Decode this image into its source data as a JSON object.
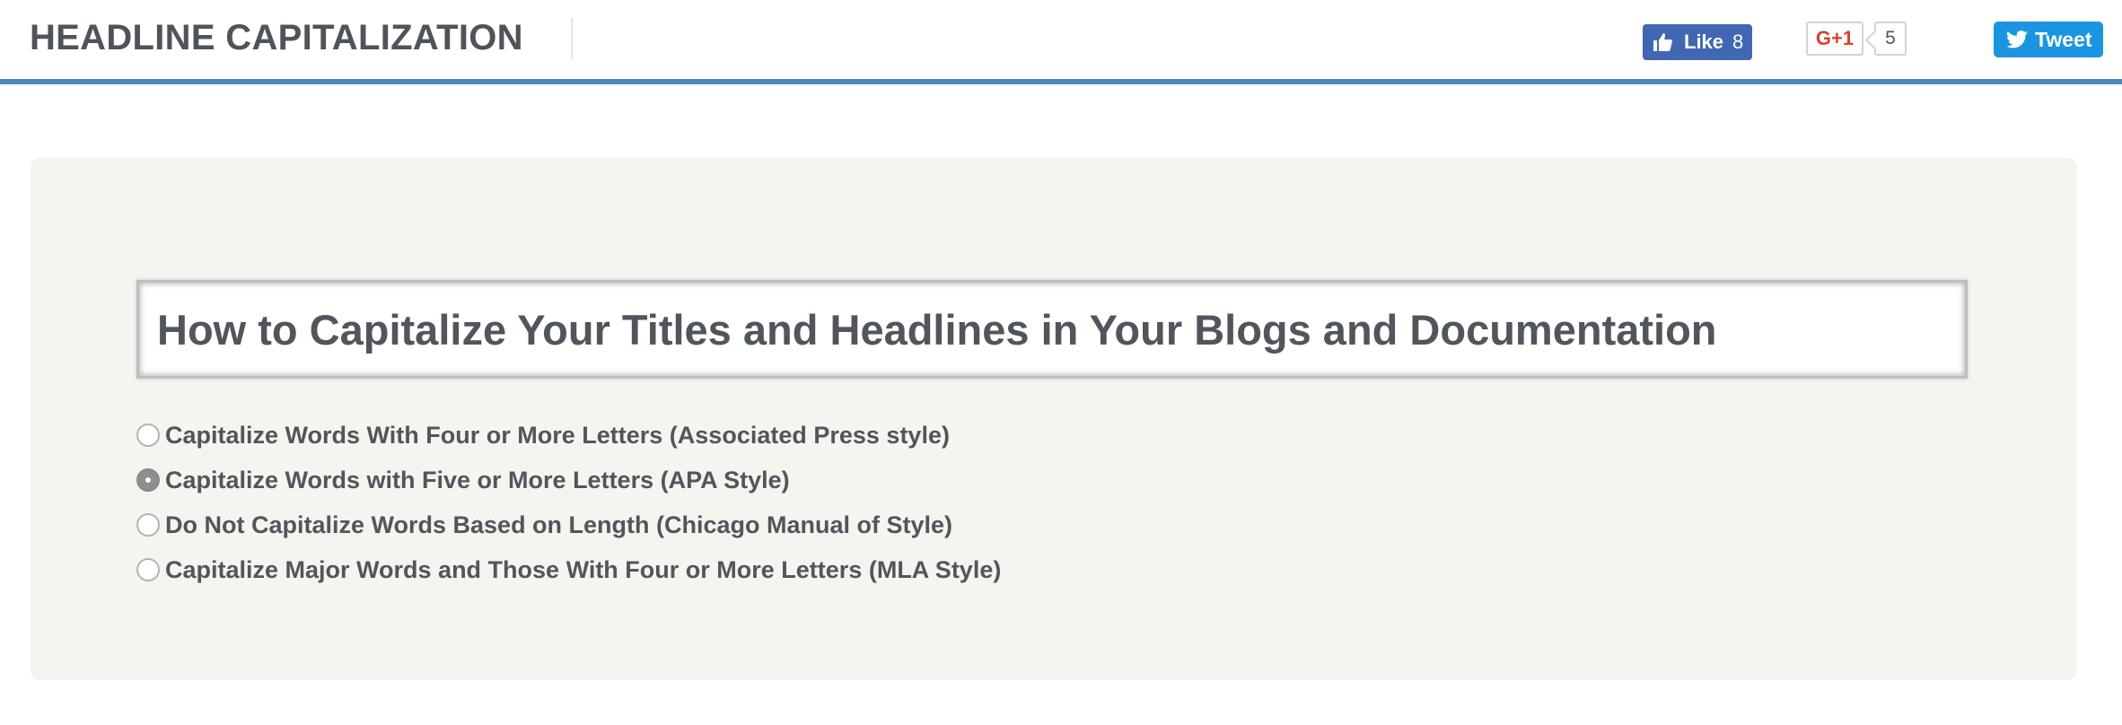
{
  "header": {
    "site_title": "HEADLINE CAPITALIZATION",
    "facebook": {
      "label": "Like",
      "count": "8",
      "color": "#4267b2"
    },
    "google_plus": {
      "label": "G+1",
      "count": "5",
      "color": "#d5412f"
    },
    "twitter": {
      "label": "Tweet",
      "color": "#1b95e0"
    },
    "accent_color": "#4a8bbd"
  },
  "main": {
    "headline_input": {
      "value": "How to Capitalize Your Titles and Headlines in Your Blogs and Documentation"
    },
    "options": [
      {
        "label": "Capitalize Words With Four or More Letters (Associated Press style)",
        "checked": false
      },
      {
        "label": "Capitalize Words with Five or More Letters (APA Style)",
        "checked": true
      },
      {
        "label": "Do Not Capitalize Words Based on Length (Chicago Manual of Style)",
        "checked": false
      },
      {
        "label": "Capitalize Major Words and Those With Four or More Letters (MLA Style)",
        "checked": false
      }
    ]
  }
}
